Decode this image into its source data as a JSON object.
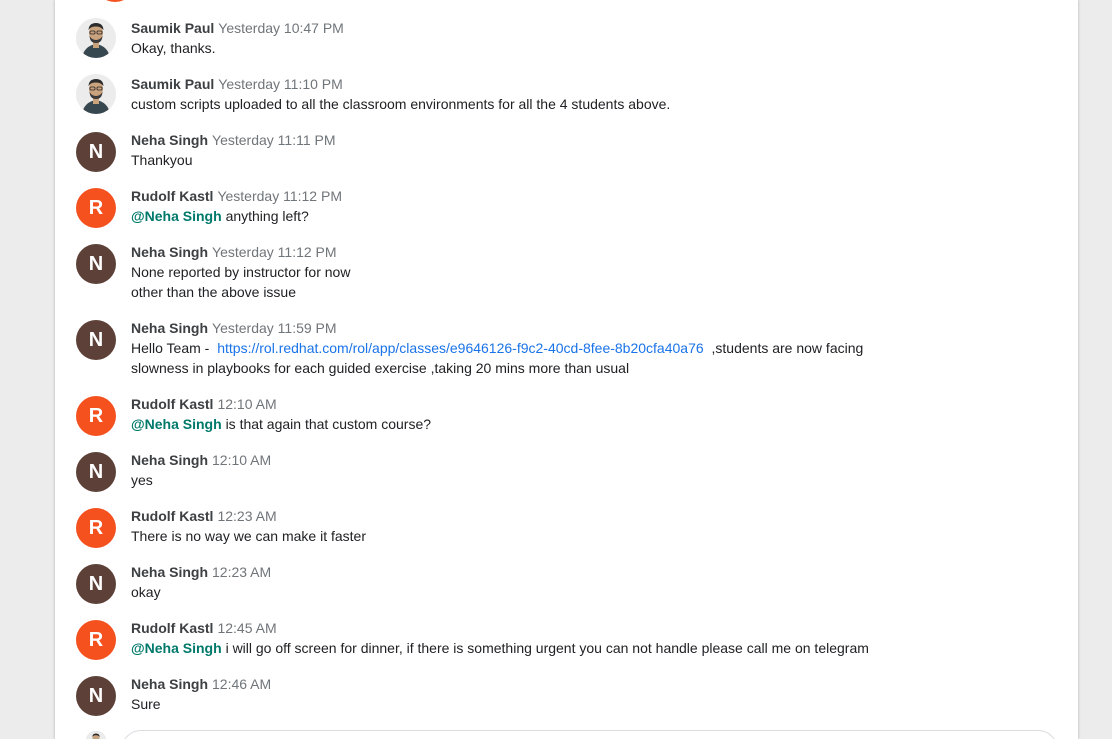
{
  "messages": [
    {
      "author": "Saumik Paul",
      "time": "Yesterday 10:47 PM",
      "lines": [
        "Okay, thanks."
      ]
    },
    {
      "author": "Saumik Paul",
      "time": "Yesterday 11:10 PM",
      "lines": [
        "custom scripts uploaded to all the classroom environments for all the 4 students above."
      ]
    },
    {
      "author": "Neha Singh",
      "initial": "N",
      "time": "Yesterday 11:11 PM",
      "lines": [
        "Thankyou"
      ]
    },
    {
      "author": "Rudolf Kastl",
      "initial": "R",
      "time": "Yesterday 11:12 PM",
      "mention": "@Neha Singh",
      "text": "anything left?"
    },
    {
      "author": "Neha Singh",
      "initial": "N",
      "time": "Yesterday 11:12 PM",
      "lines": [
        "None reported by instructor for now",
        "other than the above issue"
      ]
    },
    {
      "author": "Neha Singh",
      "initial": "N",
      "time": "Yesterday 11:59 PM",
      "prefix": "Hello Team -",
      "link": "https://rol.redhat.com/rol/app/classes/e9646126-f9c2-40cd-8fee-8b20cfa40a76",
      "suffix": ",students are now facing",
      "line2": "slowness in playbooks for each guided exercise ,taking 20 mins more than usual"
    },
    {
      "author": "Rudolf Kastl",
      "initial": "R",
      "time": "12:10 AM",
      "mention": "@Neha Singh",
      "text": "is that again that custom course?"
    },
    {
      "author": "Neha Singh",
      "initial": "N",
      "time": "12:10 AM",
      "lines": [
        "yes"
      ]
    },
    {
      "author": "Rudolf Kastl",
      "initial": "R",
      "time": "12:23 AM",
      "lines": [
        "There is no way we can make it faster"
      ]
    },
    {
      "author": "Neha Singh",
      "initial": "N",
      "time": "12:23 AM",
      "lines": [
        "okay"
      ]
    },
    {
      "author": "Rudolf Kastl",
      "initial": "R",
      "time": "12:45 AM",
      "mention": "@Neha Singh",
      "text": "i will go off screen for dinner, if there is something urgent you can not handle please call me on telegram"
    },
    {
      "author": "Neha Singh",
      "initial": "N",
      "time": "12:46 AM",
      "lines": [
        "Sure"
      ]
    }
  ],
  "colors": {
    "neha_avatar": "#5d4037",
    "rudolf_avatar": "#f4511e",
    "mention": "#00796b",
    "link": "#1a73e8"
  }
}
